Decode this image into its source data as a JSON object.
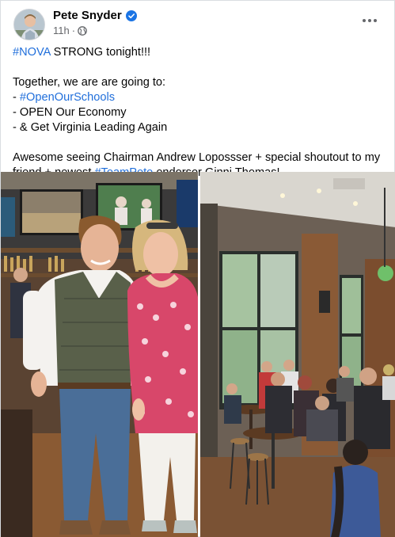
{
  "post": {
    "author": "Pete Snyder",
    "verified_icon": "verified-badge-icon",
    "time": "11h",
    "separator": "·",
    "audience_icon": "globe-icon",
    "more_icon": "more-options-icon",
    "text": {
      "line1": {
        "tag": "#NOVA",
        "rest": " STRONG tonight!!!"
      },
      "line2": "Together, we are are going to:",
      "line3": {
        "prefix": "- ",
        "tag": "#OpenOurSchools"
      },
      "line4": "- OPEN Our Economy",
      "line5": "- & Get Virginia Leading Again",
      "line6a": "Awesome seeing Chairman Andrew Lopossser + special shoutout to my friend + newest ",
      "line6tag": "#TeamPete",
      "line6b": " endorser Ginni Thomas!"
    },
    "photos": [
      {
        "name": "photo-two-people-restaurant"
      },
      {
        "name": "photo-crowd-restaurant"
      }
    ]
  },
  "colors": {
    "link": "#216fdb",
    "verified": "#1b74e4",
    "meta": "#65676b"
  }
}
